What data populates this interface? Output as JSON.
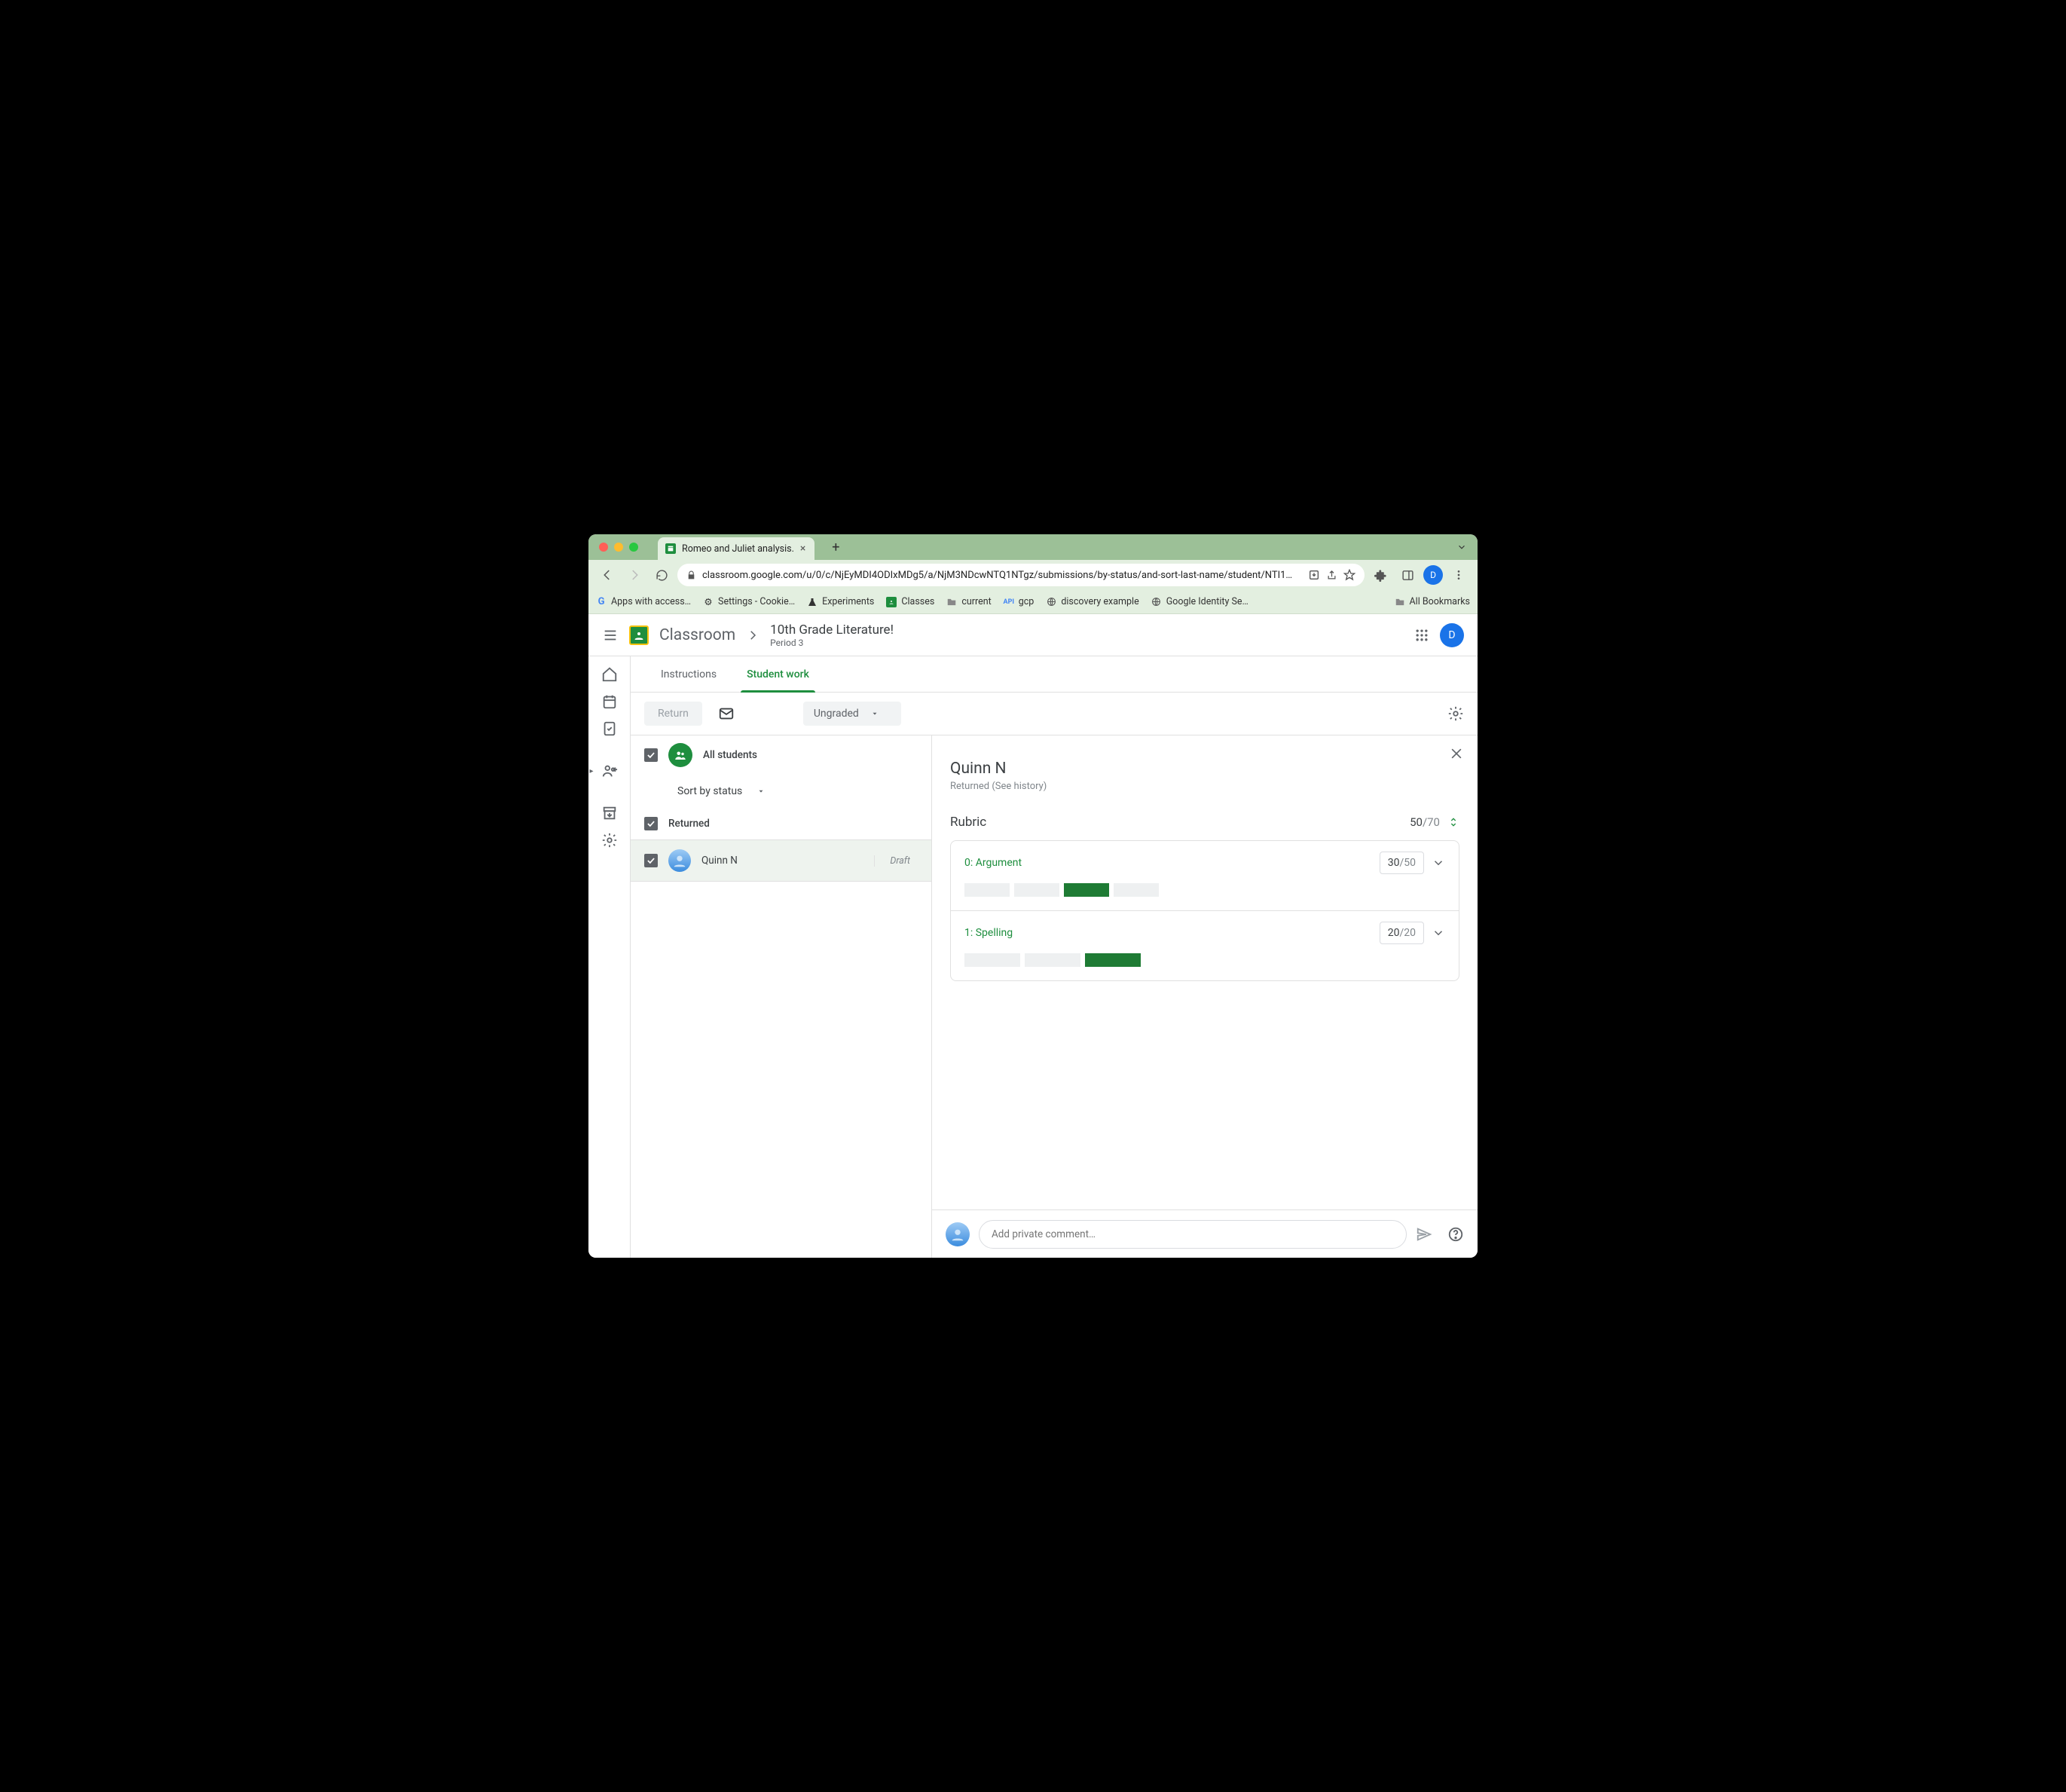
{
  "browser": {
    "tab_title": "Romeo and Juliet analysis.",
    "url": "classroom.google.com/u/0/c/NjEyMDI4ODIxMDg5/a/NjM3NDcwNTQ1NTgz/submissions/by-status/and-sort-last-name/student/NTI1…",
    "bookmarks": {
      "b1": "Apps with access…",
      "b2": "Settings - Cookie…",
      "b3": "Experiments",
      "b4": "Classes",
      "b5": "current",
      "b6": "gcp",
      "b7": "discovery example",
      "b8": "Google Identity Se…",
      "all": "All Bookmarks"
    }
  },
  "header": {
    "product": "Classroom",
    "class_name": "10th Grade Literature!",
    "class_sub": "Period 3",
    "avatar_letter": "D"
  },
  "tabs": {
    "instructions": "Instructions",
    "student_work": "Student work"
  },
  "actionbar": {
    "return": "Return",
    "filter": "Ungraded"
  },
  "studentlist": {
    "all": "All students",
    "sort": "Sort by status",
    "section": "Returned",
    "students": [
      {
        "name": "Quinn N",
        "status": "Draft"
      }
    ]
  },
  "detail": {
    "name": "Quinn N",
    "status": "Returned (See history)",
    "rubric_label": "Rubric",
    "total_score": "50",
    "total_max": "/70",
    "criteria": [
      {
        "label": "0: Argument",
        "score": "30",
        "max": "/50",
        "levels": 4,
        "selected": 2
      },
      {
        "label": "1: Spelling",
        "score": "20",
        "max": "/20",
        "levels": 3,
        "selected": 2
      }
    ],
    "comment_placeholder": "Add private comment…"
  }
}
